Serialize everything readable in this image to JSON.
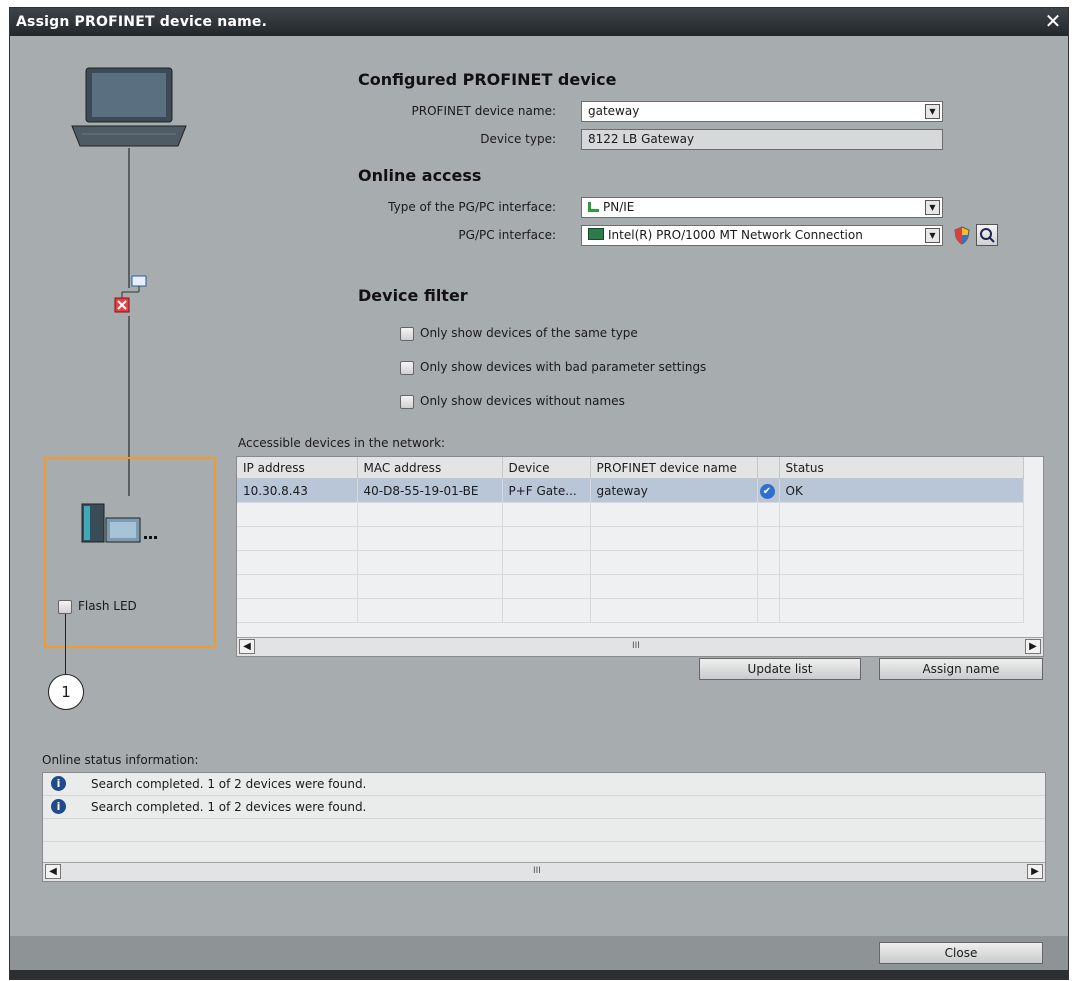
{
  "dialog": {
    "title": "Assign PROFINET device name.",
    "close_glyph": "✕"
  },
  "configured": {
    "heading": "Configured PROFINET device",
    "device_name_label": "PROFINET device name:",
    "device_name_value": "gateway",
    "device_type_label": "Device type:",
    "device_type_value": "8122 LB Gateway"
  },
  "online": {
    "heading": "Online access",
    "iface_type_label": "Type of the PG/PC interface:",
    "iface_type_value": "PN/IE",
    "iface_label": "PG/PC interface:",
    "iface_value": "Intel(R) PRO/1000 MT Network Connection"
  },
  "filter": {
    "heading": "Device filter",
    "options": [
      "Only show devices of the same type",
      "Only show devices with bad parameter settings",
      "Only show devices without names"
    ]
  },
  "devices": {
    "caption": "Accessible devices in the network:",
    "columns": [
      "IP address",
      "MAC address",
      "Device",
      "PROFINET device name",
      "",
      "Status"
    ],
    "rows": [
      {
        "ip": "10.30.8.43",
        "mac": "40-D8-55-19-01-BE",
        "device": "P+F Gate...",
        "name": "gateway",
        "check": "✔",
        "status": "OK"
      }
    ],
    "scroll_thumb": "III"
  },
  "buttons": {
    "update": "Update list",
    "assign": "Assign name",
    "close": "Close"
  },
  "flash_led": {
    "label": "Flash LED",
    "callout": "1"
  },
  "status": {
    "caption": "Online status information:",
    "messages": [
      "Search completed. 1 of 2 devices were found.",
      "Search completed. 1 of 2 devices were found."
    ],
    "scroll_thumb": "III"
  },
  "colors": {
    "highlight_box": "#f39a2b",
    "selected_row": "#b9c6d8",
    "title_bar": "#2e3437"
  }
}
